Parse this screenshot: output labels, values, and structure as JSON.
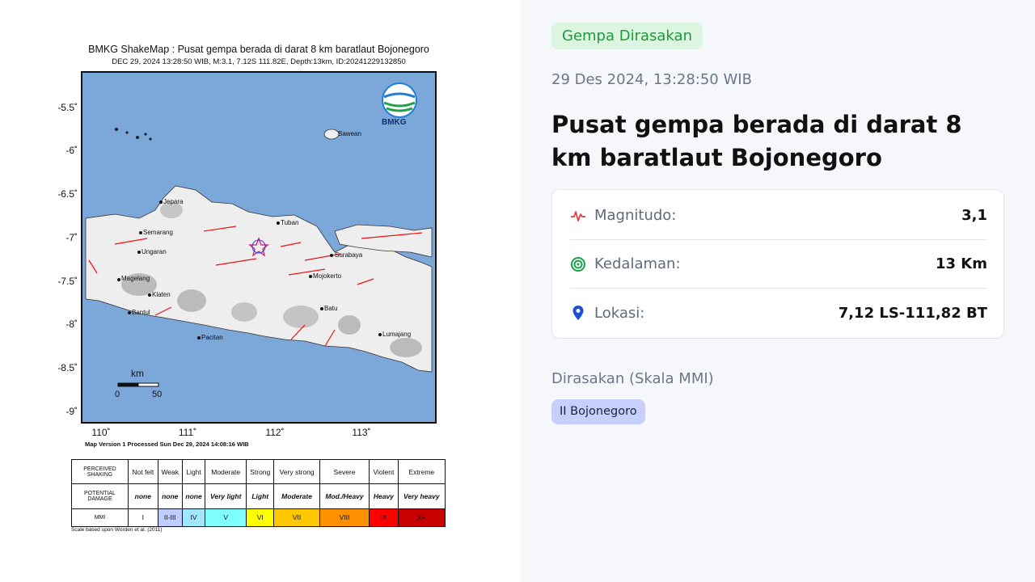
{
  "shakemap": {
    "title": "BMKG ShakeMap : Pusat gempa berada di darat 8 km baratlaut Bojonegoro",
    "subtitle": "DEC 29, 2024 13:28:50 WIB, M:3.1, 7.12S 111.82E, Depth:13km, ID:20241229132850",
    "logo_text": "BMKG",
    "y_ticks": [
      "-5.5˚",
      "-6˚",
      "-6.5˚",
      "-7˚",
      "-7.5˚",
      "-8˚",
      "-8.5˚",
      "-9˚"
    ],
    "x_ticks": [
      "110˚",
      "111˚",
      "112˚",
      "113˚"
    ],
    "places": [
      "Bawean",
      "Jepara",
      "Tuban",
      "Semarang",
      "Ungaran",
      "Surabaya",
      "Magelang",
      "Mojokerto",
      "Klaten",
      "Bantul",
      "Batu",
      "Lumajang",
      "Pacitan"
    ],
    "scale_bar": {
      "unit": "km",
      "min": "0",
      "max": "50"
    },
    "map_version": "Map Version 1 Processed Sun Dec 29, 2024 14:08:16 WIB",
    "scale_note": "Scale based upon Worden et al. (2011)",
    "legend": {
      "row_headers": [
        "PERCEIVED SHAKING",
        "POTENTIAL DAMAGE",
        "MMI"
      ],
      "shaking": [
        "Not felt",
        "Weak",
        "Light",
        "Moderate",
        "Strong",
        "Very strong",
        "Severe",
        "Violent",
        "Extreme"
      ],
      "damage": [
        "none",
        "none",
        "none",
        "Very light",
        "Light",
        "Moderate",
        "Mod./Heavy",
        "Heavy",
        "Very heavy"
      ],
      "mmi": [
        "I",
        "II-III",
        "IV",
        "V",
        "VI",
        "VII",
        "VIII",
        "IX",
        "X+"
      ],
      "mmi_colors": [
        "#ffffff",
        "#bfccff",
        "#a0e6ff",
        "#80ffff",
        "#ffff00",
        "#ffc800",
        "#ff9100",
        "#ff0000",
        "#c80000"
      ]
    }
  },
  "event": {
    "felt_badge": "Gempa Dirasakan",
    "datetime": "29 Des 2024, 13:28:50 WIB",
    "headline": "Pusat gempa berada di darat 8 km baratlaut Bojonegoro",
    "details": [
      {
        "icon": "pulse-icon",
        "label": "Magnitudo:",
        "value": "3,1"
      },
      {
        "icon": "target-icon",
        "label": "Kedalaman:",
        "value": "13 Km"
      },
      {
        "icon": "location-pin-icon",
        "label": "Lokasi:",
        "value": "7,12 LS-111,82 BT"
      }
    ],
    "felt_heading": "Dirasakan (Skala MMI)",
    "felt_regions": [
      "II Bojonegoro"
    ]
  },
  "colors": {
    "badge_bg": "#dcf5e1",
    "badge_text": "#1f9a3b",
    "chip_bg": "#c7d0fb",
    "pulse_icon": "#e53935",
    "target_icon": "#16a34a",
    "pin_icon": "#1d4ed8",
    "sea": "#7ba7d9"
  }
}
